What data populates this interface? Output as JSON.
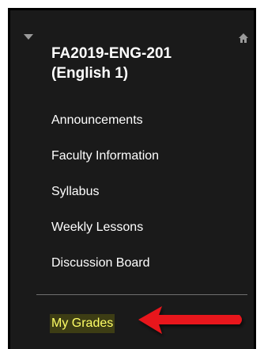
{
  "course": {
    "title_line1": "FA2019-ENG-201",
    "title_line2": "(English 1)"
  },
  "menu": {
    "items": [
      {
        "label": "Announcements"
      },
      {
        "label": "Faculty Information"
      },
      {
        "label": "Syllabus"
      },
      {
        "label": "Weekly Lessons"
      },
      {
        "label": "Discussion Board"
      }
    ],
    "highlighted_item": "My Grades"
  },
  "icons": {
    "collapse": "caret-down-icon",
    "home": "home-icon",
    "annotation": "red-arrow-icon"
  },
  "colors": {
    "background": "#1a1a1a",
    "text": "#ffffff",
    "highlight_text": "#ffff66",
    "highlight_bg": "#3d3d14",
    "arrow": "#e8141c"
  }
}
